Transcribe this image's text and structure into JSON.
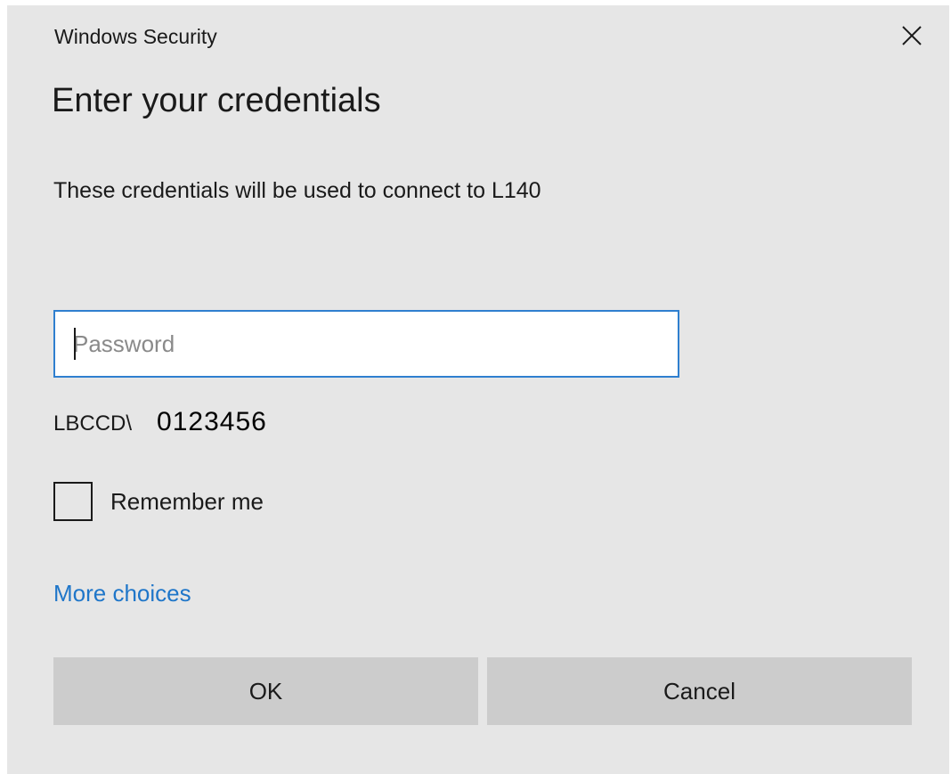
{
  "window": {
    "title": "Windows Security",
    "close_icon": "close-icon"
  },
  "dialog": {
    "heading": "Enter your credentials",
    "description": "These credentials will be used to connect to L140"
  },
  "password": {
    "value": "",
    "placeholder": "Password"
  },
  "account": {
    "domain": "LBCCD\\",
    "username": "0123456"
  },
  "remember": {
    "label": "Remember me",
    "checked": false
  },
  "links": {
    "more_choices": "More choices"
  },
  "buttons": {
    "ok": "OK",
    "cancel": "Cancel"
  },
  "colors": {
    "background": "#e6e6e6",
    "accent": "#2f7fcf",
    "link": "#1f76c9",
    "button": "#cccccc"
  }
}
